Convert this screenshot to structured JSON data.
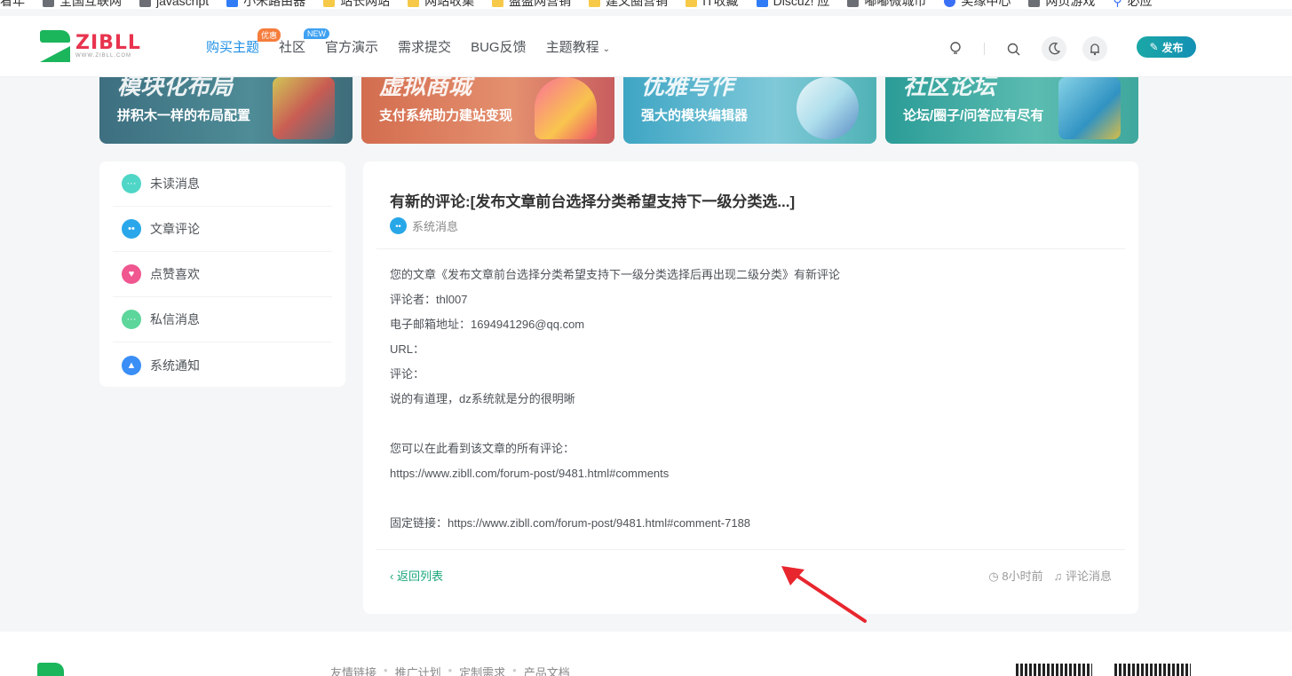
{
  "bookmarks": [
    {
      "label": "看年",
      "icon": "doc-icon"
    },
    {
      "label": "全国互联网",
      "icon": "doc-icon"
    },
    {
      "label": "javascript",
      "icon": "doc-icon"
    },
    {
      "label": "小米路由器",
      "icon": "blue-icon"
    },
    {
      "label": "站长网站",
      "icon": "folder-icon"
    },
    {
      "label": "网站收集",
      "icon": "folder-icon"
    },
    {
      "label": "盈盈网营销",
      "icon": "folder-icon"
    },
    {
      "label": "建文圈营销",
      "icon": "folder-icon"
    },
    {
      "label": "IT收藏",
      "icon": "folder-icon"
    },
    {
      "label": "Discuz! 应",
      "icon": "blue-icon"
    },
    {
      "label": "嘟嘟微城市",
      "icon": "doc-icon"
    },
    {
      "label": "奖缘中心",
      "icon": "circle-icon"
    },
    {
      "label": "网页游戏",
      "icon": "doc-icon"
    },
    {
      "label": "必应",
      "icon": "search-icon"
    }
  ],
  "header": {
    "logo_text": "ZIBLL",
    "logo_sub": "WWW.ZIBLL.COM",
    "nav": [
      {
        "label": "购买主题",
        "badge": "优惠",
        "active": true
      },
      {
        "label": "社区",
        "badge": "NEW"
      },
      {
        "label": "官方演示"
      },
      {
        "label": "需求提交"
      },
      {
        "label": "BUG反馈"
      },
      {
        "label": "主题教程",
        "dropdown": true
      }
    ],
    "publish_label": "发布"
  },
  "banners": [
    {
      "title": "模块化布局",
      "subtitle": "拼积木一样的布局配置"
    },
    {
      "title": "虚拟商城",
      "subtitle": "支付系统助力建站变现"
    },
    {
      "title": "优雅写作",
      "subtitle": "强大的模块编辑器"
    },
    {
      "title": "社区论坛",
      "subtitle": "论坛/圈子/问答应有尽有"
    }
  ],
  "sidebar": {
    "items": [
      {
        "label": "未读消息",
        "icon": "unread-message-icon",
        "color": "#4fd6c7"
      },
      {
        "label": "文章评论",
        "icon": "comment-icon",
        "color": "#2aa7ea"
      },
      {
        "label": "点赞喜欢",
        "icon": "heart-icon",
        "color": "#f0568f"
      },
      {
        "label": "私信消息",
        "icon": "chat-icon",
        "color": "#5cd69b"
      },
      {
        "label": "系统通知",
        "icon": "bell-icon",
        "color": "#3a8ef5"
      }
    ]
  },
  "message": {
    "title": "有新的评论:[发布文章前台选择分类希望支持下一级分类选...]",
    "category": "系统消息",
    "body": [
      "您的文章《发布文章前台选择分类希望支持下一级分类选择后再出现二级分类》有新评论",
      "评论者：thl007",
      "电子邮箱地址：1694941296@qq.com",
      "URL：",
      "评论：",
      "说的有道理，dz系统就是分的很明晰",
      "",
      "您可以在此看到该文章的所有评论：",
      "https://www.zibll.com/forum-post/9481.html#comments",
      "",
      "固定链接：https://www.zibll.com/forum-post/9481.html#comment-7188"
    ],
    "back_label": "‹ 返回列表",
    "time": "8小时前",
    "type": "评论消息"
  },
  "footer": {
    "links": [
      "友情链接",
      "推广计划",
      "定制需求",
      "产品文档"
    ]
  },
  "colors": {
    "accent": "#1f8fe5",
    "brand_green": "#1bb55c",
    "link_green": "#1aa77c"
  }
}
